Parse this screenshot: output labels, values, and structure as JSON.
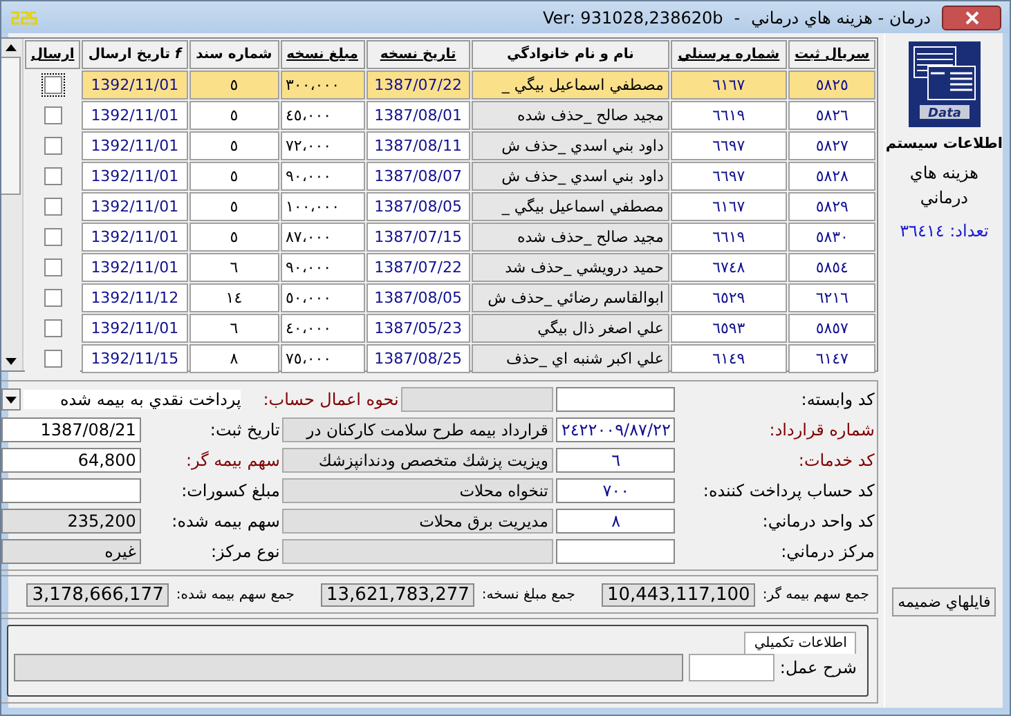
{
  "window": {
    "title": "درمان - هزينه هاي درماني",
    "title_separator": "-",
    "version": "Ver: 931028,238620b"
  },
  "grid": {
    "columns": [
      {
        "label": "سريال ثبت",
        "sortable": true
      },
      {
        "label": "شماره پرسنلي",
        "sortable": true
      },
      {
        "label": "نام و نام خانوادگي",
        "sortable": false
      },
      {
        "label": "تاريخ نسخه",
        "sortable": true
      },
      {
        "label": "مبلغ نسخه",
        "sortable": true
      },
      {
        "label": "شماره سند",
        "sortable": false
      },
      {
        "label": "*f* تاريخ ارسال",
        "sortable": false
      },
      {
        "label": "ارسال",
        "sortable": true
      }
    ],
    "rows": [
      {
        "serial": "٥٨٢٥",
        "personnel": "٦١٦٧",
        "name": "مصطفي اسماعيل بيگي _",
        "date": "1387/07/22",
        "amount": "٣٠٠،٠٠٠",
        "doc": "٥",
        "send_date": "1392/11/01",
        "sent": false,
        "selected": true
      },
      {
        "serial": "٥٨٢٦",
        "personnel": "٦٦١٩",
        "name": "مجيد صالح _حذف شده",
        "date": "1387/08/01",
        "amount": "٤٥،٠٠٠",
        "doc": "٥",
        "send_date": "1392/11/01",
        "sent": false,
        "selected": false
      },
      {
        "serial": "٥٨٢٧",
        "personnel": "٦٦٩٧",
        "name": "داود بني اسدي _حذف ش",
        "date": "1387/08/11",
        "amount": "٧٢،٠٠٠",
        "doc": "٥",
        "send_date": "1392/11/01",
        "sent": false,
        "selected": false
      },
      {
        "serial": "٥٨٢٨",
        "personnel": "٦٦٩٧",
        "name": "داود بني اسدي _حذف ش",
        "date": "1387/08/07",
        "amount": "٩٠،٠٠٠",
        "doc": "٥",
        "send_date": "1392/11/01",
        "sent": false,
        "selected": false
      },
      {
        "serial": "٥٨٢٩",
        "personnel": "٦١٦٧",
        "name": "مصطفي اسماعيل بيگي _",
        "date": "1387/08/05",
        "amount": "١٠٠،٠٠٠",
        "doc": "٥",
        "send_date": "1392/11/01",
        "sent": false,
        "selected": false
      },
      {
        "serial": "٥٨٣٠",
        "personnel": "٦٦١٩",
        "name": "مجيد صالح _حذف شده",
        "date": "1387/07/15",
        "amount": "٨٧،٠٠٠",
        "doc": "٥",
        "send_date": "1392/11/01",
        "sent": false,
        "selected": false
      },
      {
        "serial": "٥٨٥٤",
        "personnel": "٦٧٤٨",
        "name": "حميد درويشي _حذف شد",
        "date": "1387/07/22",
        "amount": "٩٠،٠٠٠",
        "doc": "٦",
        "send_date": "1392/11/01",
        "sent": false,
        "selected": false
      },
      {
        "serial": "٦٢١٦",
        "personnel": "٦٥٢٩",
        "name": "ابوالقاسم رضائي _حذف ش",
        "date": "1387/08/05",
        "amount": "٥٠،٠٠٠",
        "doc": "١٤",
        "send_date": "1392/11/12",
        "sent": false,
        "selected": false
      },
      {
        "serial": "٥٨٥٧",
        "personnel": "٦٥٩٣",
        "name": "علي اصغر ذال بيگي",
        "date": "1387/05/23",
        "amount": "٤٠،٠٠٠",
        "doc": "٦",
        "send_date": "1392/11/01",
        "sent": false,
        "selected": false
      },
      {
        "serial": "٦١٤٧",
        "personnel": "٦١٤٩",
        "name": "علي اكبر شنبه اي _حذف",
        "date": "1387/08/25",
        "amount": "٧٥،٠٠٠",
        "doc": "٨",
        "send_date": "1392/11/15",
        "sent": false,
        "selected": false
      }
    ]
  },
  "form": {
    "rows": [
      {
        "kind": "dropdown",
        "label": "كد وابسته:",
        "required": false,
        "value": "",
        "description": "",
        "side_label": "نحوه اعمال حساب:",
        "side_required": true,
        "side_value": "پرداخت نقدي به بيمه شده"
      },
      {
        "kind": "field",
        "label": "شماره قرارداد:",
        "required": true,
        "value": "٢٤٢٢٠٠٩/٨٧/٢٢",
        "description": "قرارداد بيمه طرح سلامت كاركنان در",
        "side_label": "تاريخ ثبت:",
        "side_required": false,
        "side_value": "1387/08/21",
        "side_readonly": false
      },
      {
        "kind": "field",
        "label": "كد خدمات:",
        "required": true,
        "value": "٦",
        "description": "ويزيت پزشك متخصص ودندانپزشك",
        "side_label": "سهم بيمه گر:",
        "side_required": true,
        "side_value": "64,800",
        "side_readonly": false
      },
      {
        "kind": "field",
        "label": "كد حساب پرداخت كننده:",
        "required": false,
        "value": "٧٠٠",
        "description": "تنخواه محلات",
        "side_label": "مبلغ كسورات:",
        "side_required": false,
        "side_value": "",
        "side_readonly": false
      },
      {
        "kind": "field",
        "label": "كد واحد درماني:",
        "required": false,
        "value": "٨",
        "description": "مديريت برق محلات",
        "side_label": "سهم بيمه شده:",
        "side_required": false,
        "side_value": "235,200",
        "side_readonly": true
      },
      {
        "kind": "field",
        "label": "مركز درماني:",
        "required": false,
        "value": "",
        "description": "",
        "side_label": "نوع مركز:",
        "side_required": false,
        "side_value": "غيره",
        "side_readonly": true
      }
    ]
  },
  "totals": [
    {
      "label": "جمع سهم بيمه گر:",
      "value": "10,443,117,100"
    },
    {
      "label": "جمع مبلغ نسخه:",
      "value": "13,621,783,277"
    },
    {
      "label": "جمع سهم بيمه شده:",
      "value": "3,178,666,177"
    }
  ],
  "extra": {
    "tab": "اطلاعات تكميلي",
    "label": "شرح عمل:"
  },
  "side": {
    "logo_text": "Data",
    "system": "اطلاعات سيستم",
    "module": "هزينه هاي درماني",
    "count": "تعداد: ٣٦٤١٤",
    "attachments_button": "فايلهاي ضميمه"
  }
}
